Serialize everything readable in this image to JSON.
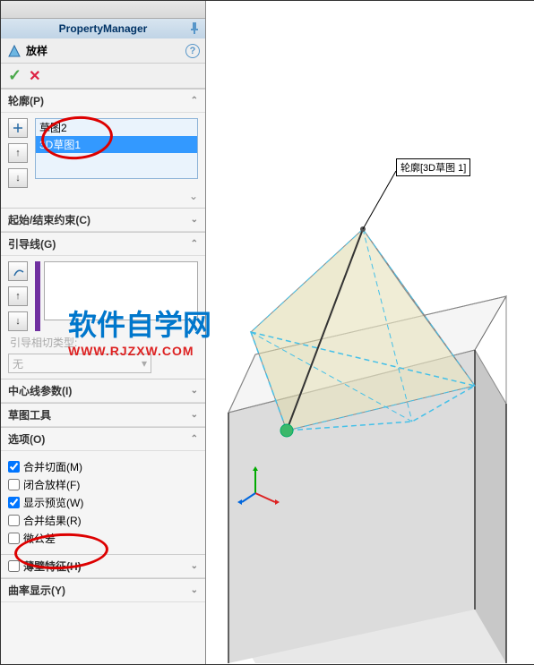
{
  "titlebar": {
    "title": "PropertyManager"
  },
  "feature": {
    "name": "放样"
  },
  "sections": {
    "profiles": {
      "label": "轮廓(P)",
      "items": [
        "草图2",
        "3D草图1"
      ]
    },
    "startEnd": {
      "label": "起始/结束约束(C)"
    },
    "guides": {
      "label": "引导线(G)",
      "tangentLabel": "引导相切类型:",
      "tangentValue": "无"
    },
    "centerline": {
      "label": "中心线参数(I)"
    },
    "sketchTools": {
      "label": "草图工具"
    },
    "options": {
      "label": "选项(O)",
      "mergeTangent": "合并切面(M)",
      "closeLoft": "闭合放样(F)",
      "showPreview": "显示预览(W)",
      "mergeResult": "合并结果(R)",
      "microTol": "微公差"
    },
    "thin": {
      "label": "薄壁特征(H)"
    },
    "curvature": {
      "label": "曲率显示(Y)"
    }
  },
  "viewportLabel": "轮廓[3D草图 1]",
  "watermark": {
    "big": "软件自学网",
    "small": "WWW.RJZXW.COM"
  }
}
